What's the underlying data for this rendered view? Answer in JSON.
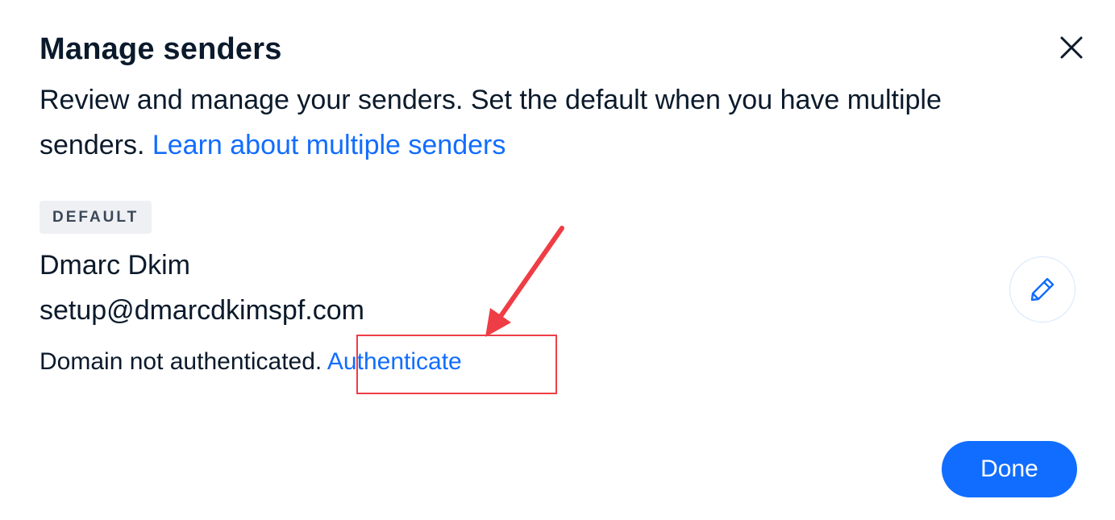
{
  "dialog": {
    "title": "Manage senders",
    "description_text": "Review and manage your senders. Set the default when you have multiple senders. ",
    "learn_link": "Learn about multiple senders",
    "close_icon": "close-icon"
  },
  "sender": {
    "badge": "DEFAULT",
    "name": "Dmarc Dkim",
    "email": "setup@dmarcdkimspf.com",
    "status_text": "Domain not authenticated. ",
    "authenticate_link": "Authenticate",
    "edit_icon": "pencil-icon"
  },
  "footer": {
    "done_label": "Done"
  },
  "annotation": {
    "highlight_color": "#ef3d45"
  },
  "colors": {
    "accent": "#116dff",
    "text": "#0b1a2b",
    "badge_bg": "#eef0f3"
  }
}
